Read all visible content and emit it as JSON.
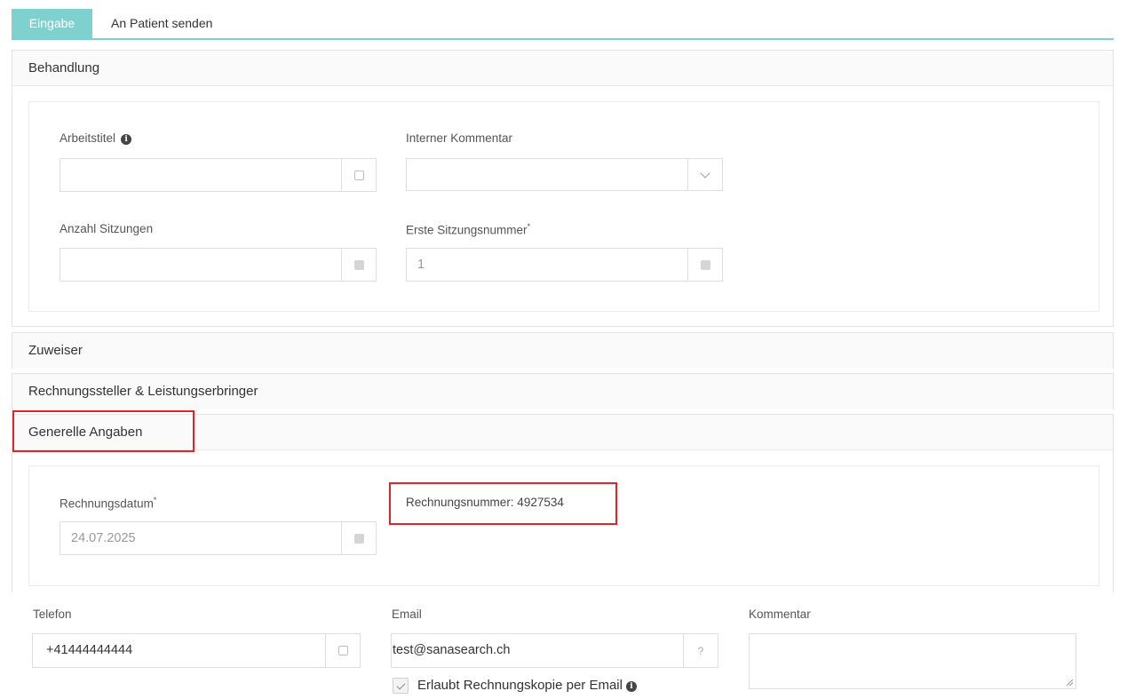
{
  "tabs": [
    {
      "label": "Eingabe",
      "active": true
    },
    {
      "label": "An Patient senden",
      "active": false
    }
  ],
  "behandlung": {
    "title": "Behandlung",
    "arbeitstitel_label": "Arbeitstitel",
    "arbeitstitel_value": "",
    "interner_kommentar_label": "Interner Kommentar",
    "interner_kommentar_value": "",
    "anzahl_sitzungen_label": "Anzahl Sitzungen",
    "anzahl_sitzungen_value": "",
    "erste_sitzungsnummer_label": "Erste Sitzungsnummer",
    "erste_sitzungsnummer_required": "*",
    "erste_sitzungsnummer_value": "1"
  },
  "zuweiser": {
    "title": "Zuweiser"
  },
  "rechnungssteller": {
    "title": "Rechnungssteller & Leistungserbringer"
  },
  "generelle": {
    "title": "Generelle Angaben",
    "rechnungsdatum_label": "Rechnungsdatum",
    "rechnungsdatum_required": "*",
    "rechnungsdatum_value": "24.07.2025",
    "rechnungsnummer_text": "Rechnungsnummer: 4927534"
  },
  "contact": {
    "telefon_label": "Telefon",
    "telefon_value": "+41444444444",
    "email_label": "Email",
    "email_value": "test@sanasearch.ch",
    "email_help": "?",
    "kommentar_label": "Kommentar",
    "kommentar_value": "",
    "email_copy_label": "Erlaubt Rechnungskopie per Email",
    "email_copy_checked": true
  },
  "colors": {
    "accent": "#7fd1cf",
    "highlight": "#e0242b"
  }
}
